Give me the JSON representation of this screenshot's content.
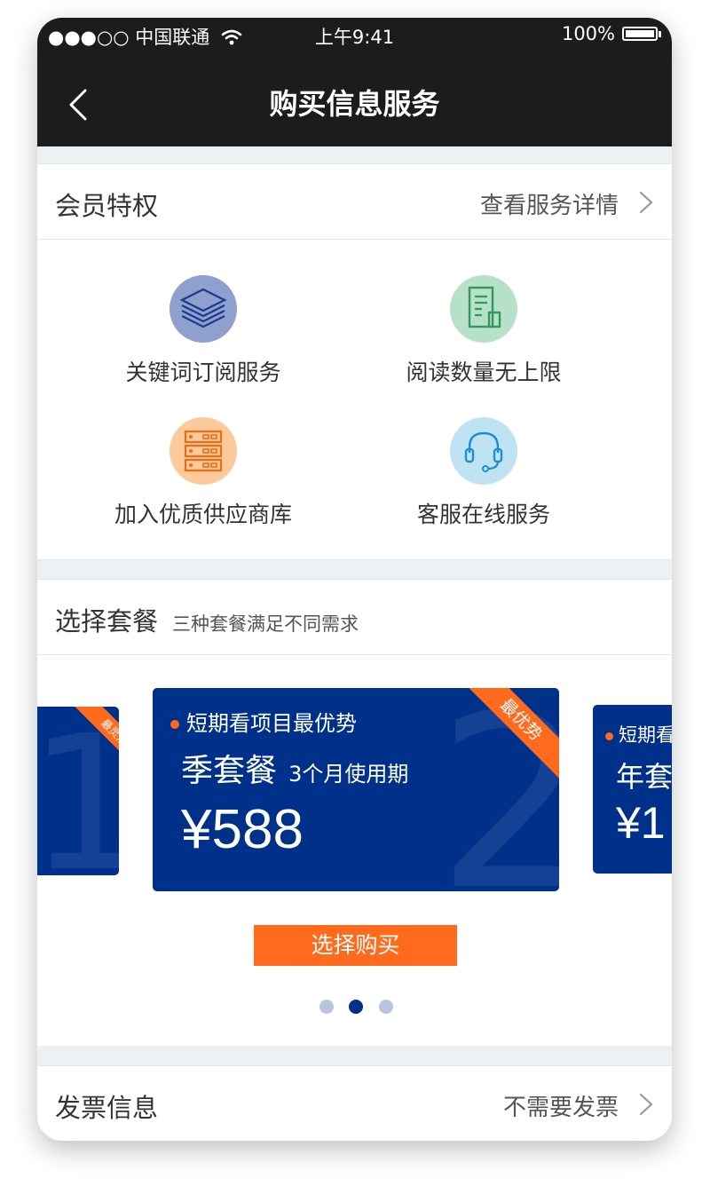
{
  "status_bar": {
    "carrier": "●●●○○ 中国联通",
    "time": "上午9:41",
    "battery": "100%"
  },
  "nav": {
    "title": "购买信息服务",
    "back_icon": "chevron-left-icon"
  },
  "membership": {
    "title": "会员特权",
    "link": "查看服务详情",
    "privileges": [
      {
        "label": "关键词订阅服务",
        "icon": "layers-icon",
        "color": "#8fa0cf"
      },
      {
        "label": "阅读数量无上限",
        "icon": "document-icon",
        "color": "#b7e0c8"
      },
      {
        "label": "加入优质供应商库",
        "icon": "server-icon",
        "color": "#fcc99a"
      },
      {
        "label": "客服在线服务",
        "icon": "headset-icon",
        "color": "#bfe3f3"
      }
    ]
  },
  "packages": {
    "title": "选择套餐",
    "subtitle": "三种套餐满足不同需求",
    "left_card": {
      "ribbon": "最灵活",
      "number": "1"
    },
    "center_card": {
      "tagline": "短期看项目最优势",
      "name": "季套餐",
      "period": "3个月使用期",
      "price": "¥588",
      "ribbon": "最优势",
      "number": "2"
    },
    "right_card": {
      "tagline": "短期看",
      "name": "年套",
      "price": "¥1"
    },
    "buy_button": "选择购买",
    "pager": {
      "count": 3,
      "active": 2
    }
  },
  "invoice": {
    "title": "发票信息",
    "value": "不需要发票"
  },
  "colors": {
    "accent": "#ff6a1d",
    "card_blue": "#00318a",
    "dark_bar": "#1c1c1e"
  }
}
